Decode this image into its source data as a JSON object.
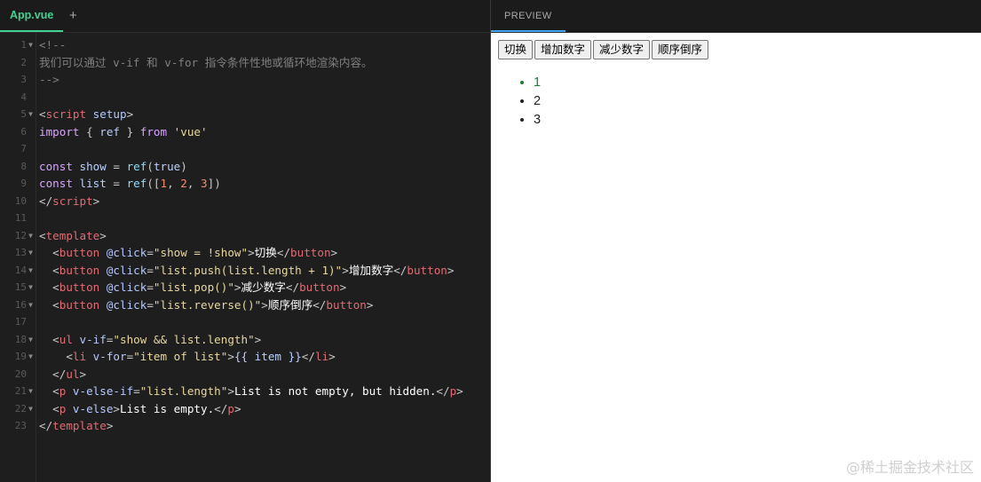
{
  "editor": {
    "tab_label": "App.vue",
    "add_tab": "+",
    "lines": [
      {
        "n": "1",
        "fold": "v",
        "seg": [
          [
            "c",
            "<!--"
          ]
        ]
      },
      {
        "n": "2",
        "fold": "",
        "seg": [
          [
            "c",
            "我们可以通过 v-if 和 v-for 指令条件性地或循环地渲染内容。"
          ]
        ]
      },
      {
        "n": "3",
        "fold": "",
        "seg": [
          [
            "c",
            "-->"
          ]
        ]
      },
      {
        "n": "4",
        "fold": "",
        "seg": []
      },
      {
        "n": "5",
        "fold": "v",
        "seg": [
          [
            "p",
            "<"
          ],
          [
            "t",
            "script"
          ],
          [
            "a",
            " setup"
          ],
          [
            "p",
            ">"
          ]
        ]
      },
      {
        "n": "6",
        "fold": "",
        "seg": [
          [
            "k",
            "import"
          ],
          [
            "p",
            " { "
          ],
          [
            "v",
            "ref"
          ],
          [
            "p",
            " } "
          ],
          [
            "k",
            "from"
          ],
          [
            "s",
            " 'vue'"
          ]
        ]
      },
      {
        "n": "7",
        "fold": "",
        "seg": []
      },
      {
        "n": "8",
        "fold": "",
        "seg": [
          [
            "k",
            "const"
          ],
          [
            "v",
            " show"
          ],
          [
            "p",
            " = "
          ],
          [
            "f",
            "ref"
          ],
          [
            "p",
            "("
          ],
          [
            "v",
            "true"
          ],
          [
            "p",
            ")"
          ]
        ]
      },
      {
        "n": "9",
        "fold": "",
        "seg": [
          [
            "k",
            "const"
          ],
          [
            "v",
            " list"
          ],
          [
            "p",
            " = "
          ],
          [
            "f",
            "ref"
          ],
          [
            "p",
            "(["
          ],
          [
            "n",
            "1"
          ],
          [
            "p",
            ", "
          ],
          [
            "n",
            "2"
          ],
          [
            "p",
            ", "
          ],
          [
            "n",
            "3"
          ],
          [
            "p",
            "])"
          ]
        ]
      },
      {
        "n": "10",
        "fold": "",
        "seg": [
          [
            "p",
            "</"
          ],
          [
            "t",
            "script"
          ],
          [
            "p",
            ">"
          ]
        ]
      },
      {
        "n": "11",
        "fold": "",
        "seg": []
      },
      {
        "n": "12",
        "fold": "v",
        "seg": [
          [
            "p",
            "<"
          ],
          [
            "t",
            "template"
          ],
          [
            "p",
            ">"
          ]
        ]
      },
      {
        "n": "13",
        "fold": "v",
        "seg": [
          [
            "p",
            "  <"
          ],
          [
            "t",
            "button"
          ],
          [
            "a",
            " @click"
          ],
          [
            "p",
            "="
          ],
          [
            "s",
            "\"show = !show\""
          ],
          [
            "p",
            ">"
          ],
          [
            "w",
            "切换"
          ],
          [
            "p",
            "</"
          ],
          [
            "t",
            "button"
          ],
          [
            "p",
            ">"
          ]
        ]
      },
      {
        "n": "14",
        "fold": "v",
        "seg": [
          [
            "p",
            "  <"
          ],
          [
            "t",
            "button"
          ],
          [
            "a",
            " @click"
          ],
          [
            "p",
            "="
          ],
          [
            "s",
            "\"list.push(list.length + 1)\""
          ],
          [
            "p",
            ">"
          ],
          [
            "w",
            "增加数字"
          ],
          [
            "p",
            "</"
          ],
          [
            "t",
            "button"
          ],
          [
            "p",
            ">"
          ]
        ]
      },
      {
        "n": "15",
        "fold": "v",
        "seg": [
          [
            "p",
            "  <"
          ],
          [
            "t",
            "button"
          ],
          [
            "a",
            " @click"
          ],
          [
            "p",
            "="
          ],
          [
            "s",
            "\"list.pop()\""
          ],
          [
            "p",
            ">"
          ],
          [
            "w",
            "减少数字"
          ],
          [
            "p",
            "</"
          ],
          [
            "t",
            "button"
          ],
          [
            "p",
            ">"
          ]
        ]
      },
      {
        "n": "16",
        "fold": "v",
        "seg": [
          [
            "p",
            "  <"
          ],
          [
            "t",
            "button"
          ],
          [
            "a",
            " @click"
          ],
          [
            "p",
            "="
          ],
          [
            "s",
            "\"list.reverse()\""
          ],
          [
            "p",
            ">"
          ],
          [
            "w",
            "顺序倒序"
          ],
          [
            "p",
            "</"
          ],
          [
            "t",
            "button"
          ],
          [
            "p",
            ">"
          ]
        ]
      },
      {
        "n": "17",
        "fold": "",
        "seg": []
      },
      {
        "n": "18",
        "fold": "v",
        "seg": [
          [
            "p",
            "  <"
          ],
          [
            "t",
            "ul"
          ],
          [
            "a",
            " v-if"
          ],
          [
            "p",
            "="
          ],
          [
            "s",
            "\"show && list.length\""
          ],
          [
            "p",
            ">"
          ]
        ]
      },
      {
        "n": "19",
        "fold": "v",
        "seg": [
          [
            "p",
            "    <"
          ],
          [
            "t",
            "li"
          ],
          [
            "a",
            " v-for"
          ],
          [
            "p",
            "="
          ],
          [
            "s",
            "\"item of list\""
          ],
          [
            "p",
            ">"
          ],
          [
            "v",
            "{{ item }}"
          ],
          [
            "p",
            "</"
          ],
          [
            "t",
            "li"
          ],
          [
            "p",
            ">"
          ]
        ]
      },
      {
        "n": "20",
        "fold": "",
        "seg": [
          [
            "p",
            "  </"
          ],
          [
            "t",
            "ul"
          ],
          [
            "p",
            ">"
          ]
        ]
      },
      {
        "n": "21",
        "fold": "v",
        "seg": [
          [
            "p",
            "  <"
          ],
          [
            "t",
            "p"
          ],
          [
            "a",
            " v-else-if"
          ],
          [
            "p",
            "="
          ],
          [
            "s",
            "\"list.length\""
          ],
          [
            "p",
            ">"
          ],
          [
            "w",
            "List is not empty, but hidden."
          ],
          [
            "p",
            "</"
          ],
          [
            "t",
            "p"
          ],
          [
            "p",
            ">"
          ]
        ]
      },
      {
        "n": "22",
        "fold": "v",
        "seg": [
          [
            "p",
            "  <"
          ],
          [
            "t",
            "p"
          ],
          [
            "a",
            " v-else"
          ],
          [
            "p",
            ">"
          ],
          [
            "w",
            "List is empty."
          ],
          [
            "p",
            "</"
          ],
          [
            "t",
            "p"
          ],
          [
            "p",
            ">"
          ]
        ]
      },
      {
        "n": "23",
        "fold": "",
        "seg": [
          [
            "p",
            "</"
          ],
          [
            "t",
            "template"
          ],
          [
            "p",
            ">"
          ]
        ]
      }
    ]
  },
  "preview": {
    "tab_label": "PREVIEW",
    "buttons": [
      "切换",
      "增加数字",
      "减少数字",
      "顺序倒序"
    ],
    "list_items": [
      "1",
      "2",
      "3"
    ]
  },
  "watermark": "@稀土掘金技术社区",
  "colors": {
    "accent_green": "#42d392",
    "preview_accent": "#42a5f5"
  }
}
